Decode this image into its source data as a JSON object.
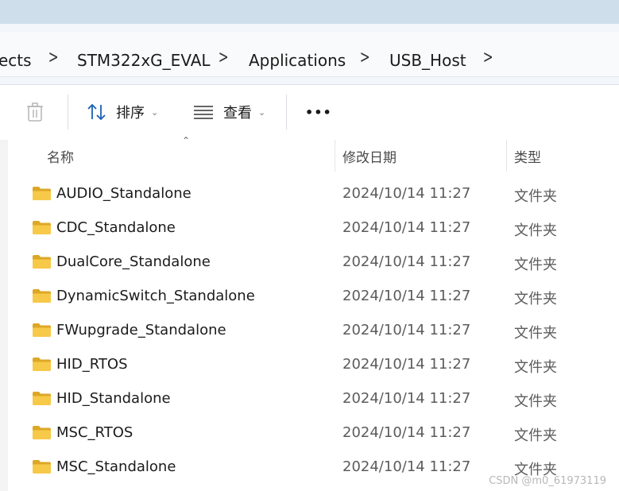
{
  "breadcrumb": {
    "items": [
      "ects",
      "STM322xG_EVAL",
      "Applications",
      "USB_Host"
    ]
  },
  "toolbar": {
    "delete_icon": "trash-icon",
    "sort_label": "排序",
    "view_label": "查看",
    "more_label": "•••"
  },
  "columns": {
    "name": "名称",
    "date": "修改日期",
    "type": "类型"
  },
  "rows": [
    {
      "name": "AUDIO_Standalone",
      "date": "2024/10/14 11:27",
      "type": "文件夹"
    },
    {
      "name": "CDC_Standalone",
      "date": "2024/10/14 11:27",
      "type": "文件夹"
    },
    {
      "name": "DualCore_Standalone",
      "date": "2024/10/14 11:27",
      "type": "文件夹"
    },
    {
      "name": "DynamicSwitch_Standalone",
      "date": "2024/10/14 11:27",
      "type": "文件夹"
    },
    {
      "name": "FWupgrade_Standalone",
      "date": "2024/10/14 11:27",
      "type": "文件夹"
    },
    {
      "name": "HID_RTOS",
      "date": "2024/10/14 11:27",
      "type": "文件夹"
    },
    {
      "name": "HID_Standalone",
      "date": "2024/10/14 11:27",
      "type": "文件夹"
    },
    {
      "name": "MSC_RTOS",
      "date": "2024/10/14 11:27",
      "type": "文件夹"
    },
    {
      "name": "MSC_Standalone",
      "date": "2024/10/14 11:27",
      "type": "文件夹"
    }
  ],
  "watermark": "CSDN @m0_61973119",
  "colors": {
    "title_bar": "#cfdeeb",
    "folder": "#f7c948"
  }
}
